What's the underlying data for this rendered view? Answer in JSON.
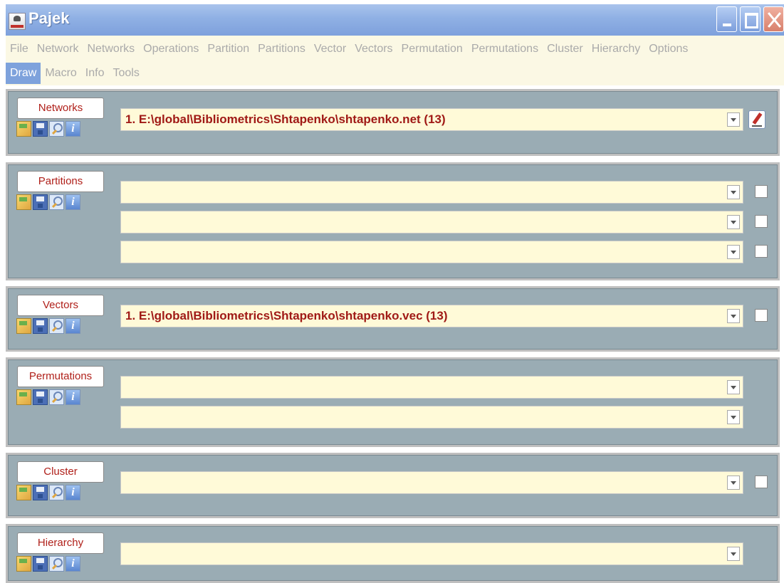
{
  "window": {
    "title": "Pajek",
    "controls": [
      "minimize",
      "maximize",
      "close"
    ]
  },
  "menu": {
    "row1": [
      "File",
      "Network",
      "Networks",
      "Operations",
      "Partition",
      "Partitions",
      "Vector",
      "Vectors",
      "Permutation",
      "Permutations",
      "Cluster",
      "Hierarchy",
      "Options"
    ],
    "row2": [
      "Draw",
      "Macro",
      "Info",
      "Tools"
    ],
    "active": "Draw"
  },
  "panels": {
    "networks": {
      "label": "Networks",
      "fields": [
        "1. E:\\global\\Bibliometrics\\Shtapenko\\shtapenko.net (13)"
      ]
    },
    "partitions": {
      "label": "Partitions",
      "fields": [
        "",
        "",
        ""
      ]
    },
    "vectors": {
      "label": "Vectors",
      "fields": [
        "1. E:\\global\\Bibliometrics\\Shtapenko\\shtapenko.vec (13)"
      ]
    },
    "permutations": {
      "label": "Permutations",
      "fields": [
        "",
        ""
      ]
    },
    "cluster": {
      "label": "Cluster",
      "fields": [
        ""
      ]
    },
    "hierarchy": {
      "label": "Hierarchy",
      "fields": [
        ""
      ]
    }
  },
  "toolbar_icons": [
    "open-icon",
    "save-icon",
    "view-icon",
    "info-icon"
  ],
  "colors": {
    "title_bar": "#8fb0e4",
    "menu_bg": "#fbf8e4",
    "panel_bg": "#9aacb4",
    "field_bg": "#fffad8",
    "field_text": "#a01a16",
    "menu_active": "#7ea2dc"
  }
}
